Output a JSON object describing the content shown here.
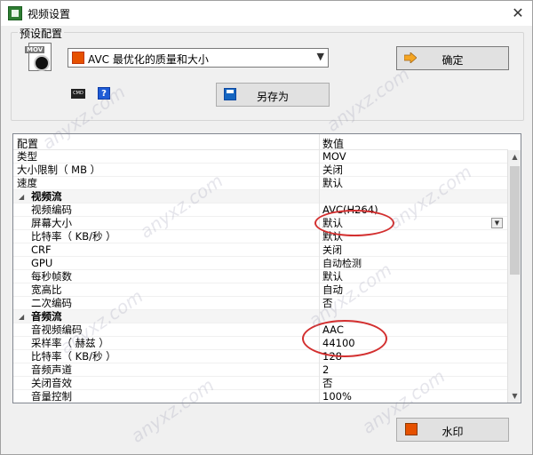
{
  "window": {
    "title": "视频设置",
    "close_glyph": "✕"
  },
  "preset": {
    "legend": "预设配置",
    "file_icon_label": "MOV",
    "combo_value": "AVC 最优化的质量和大小",
    "ok_label": "确定",
    "saveas_label": "另存为",
    "kbd_icon_label": "CMD",
    "help_icon_label": "?"
  },
  "grid": {
    "header": {
      "name": "配置",
      "value": "数值"
    },
    "rows": [
      {
        "name": "类型",
        "value": "MOV",
        "kind": "prop"
      },
      {
        "name": "大小限制（ MB ）",
        "value": "关闭",
        "kind": "prop"
      },
      {
        "name": "速度",
        "value": "默认",
        "kind": "prop"
      },
      {
        "name": "视频流",
        "value": "",
        "kind": "cat"
      },
      {
        "name": "视频编码",
        "value": "AVC(H264)",
        "kind": "child"
      },
      {
        "name": "屏幕大小",
        "value": "默认",
        "kind": "child",
        "dropdown": true
      },
      {
        "name": "比特率（ KB/秒 ）",
        "value": "默认",
        "kind": "child"
      },
      {
        "name": "CRF",
        "value": "关闭",
        "kind": "child"
      },
      {
        "name": "GPU",
        "value": "自动检测",
        "kind": "child"
      },
      {
        "name": "每秒帧数",
        "value": "默认",
        "kind": "child"
      },
      {
        "name": "宽高比",
        "value": "自动",
        "kind": "child"
      },
      {
        "name": "二次编码",
        "value": "否",
        "kind": "child"
      },
      {
        "name": "音频流",
        "value": "",
        "kind": "cat"
      },
      {
        "name": "音视频编码",
        "value": "AAC",
        "kind": "child"
      },
      {
        "name": "采样率（ 赫兹 ）",
        "value": "44100",
        "kind": "child"
      },
      {
        "name": "比特率（ KB/秒 ）",
        "value": "128",
        "kind": "child"
      },
      {
        "name": "音频声道",
        "value": "2",
        "kind": "child"
      },
      {
        "name": "关闭音效",
        "value": "否",
        "kind": "child"
      },
      {
        "name": "音量控制",
        "value": "100%",
        "kind": "child"
      }
    ]
  },
  "footer": {
    "watermark_label": "水印"
  },
  "icons": {
    "app": "app-icon",
    "file": "mov-file-icon",
    "combo": "film-icon",
    "ok": "arrow-right-icon",
    "saveas": "floppy-disk-icon",
    "watermark": "watermark-icon",
    "collapse": "triangle-down-icon"
  },
  "colors": {
    "annotation": "#d32f2f",
    "ok_arrow": "#f5a623"
  },
  "background_watermark": "anyxz.com"
}
